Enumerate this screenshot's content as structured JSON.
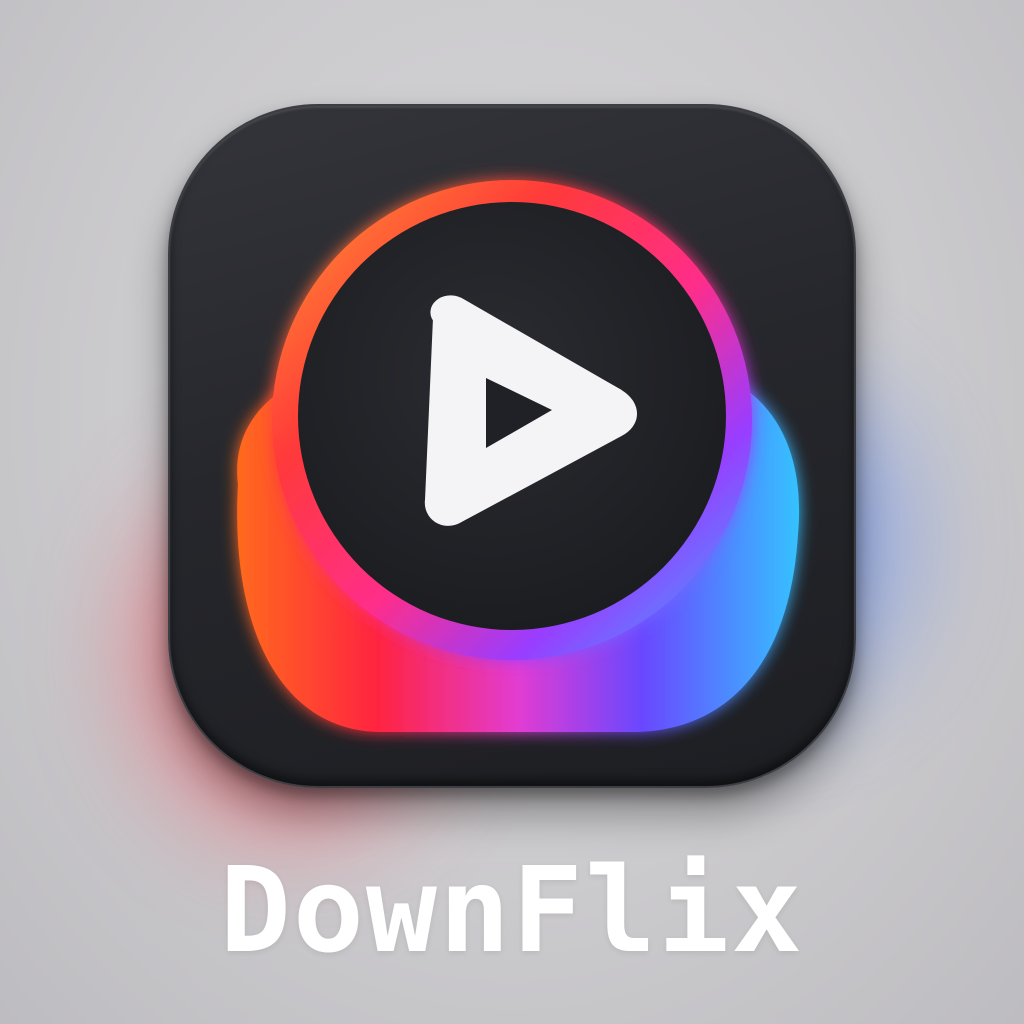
{
  "app": {
    "name": "DownFlix"
  },
  "icon": {
    "symbol": "play-icon",
    "colors": {
      "tile": "#26272c",
      "ring_gradient": [
        "#ff8a2a",
        "#ff2a4d",
        "#d23cff",
        "#5a4dff",
        "#2fa8ff"
      ],
      "play_triangle": "#f5f5f7"
    }
  }
}
